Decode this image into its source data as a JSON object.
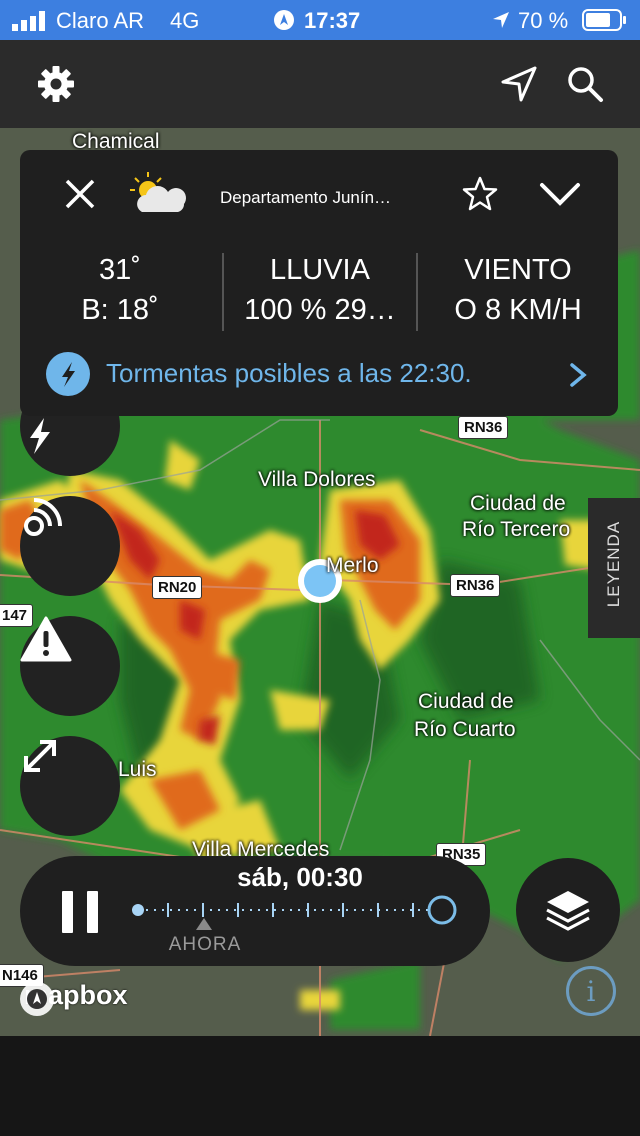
{
  "status_bar": {
    "carrier": "Claro AR",
    "network": "4G",
    "time": "17:37",
    "battery": "70 %"
  },
  "top_bar": {
    "settings_icon": "gear-icon",
    "location_icon": "navigation-arrow-icon",
    "search_icon": "search-icon"
  },
  "card": {
    "location": "Departamento Junín…",
    "temp": "31˚",
    "low": "B: 18˚",
    "rain_title": "LLUVIA",
    "rain_value": "100 % 29…",
    "wind_title": "VIENTO",
    "wind_value": "O 8 KM/H",
    "alert": "Tormentas posibles a las 22:30.",
    "colors": {
      "alert_text": "#6fb6ea",
      "background": "#1f1f1f"
    }
  },
  "map": {
    "labels": {
      "chamical": "Chamical",
      "villa_dolores": "Villa Dolores",
      "rio_tercero_1": "Ciudad de",
      "rio_tercero_2": "Río Tercero",
      "merlo": "Merlo",
      "rio_cuarto_1": "Ciudad de",
      "rio_cuarto_2": "Río Cuarto",
      "luis": "Luis",
      "villa_mercedes": "Villa Mercedes"
    },
    "roads": {
      "rn36_a": "RN36",
      "rn36_b": "RN36",
      "rn20": "RN20",
      "r147": "147",
      "rn35": "RN35",
      "rn146": "N146"
    },
    "legend": "LEYENDA",
    "attribution": "mapbox"
  },
  "timeline": {
    "time": "sáb, 00:30",
    "now_label": "AHORA"
  }
}
